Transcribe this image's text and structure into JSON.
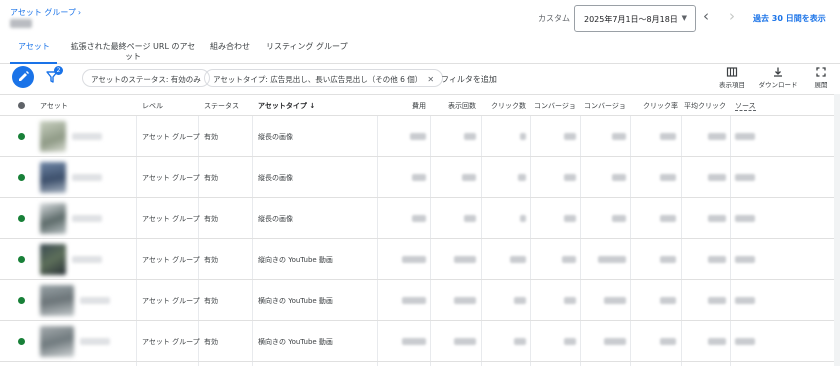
{
  "header": {
    "breadcrumb": "アセット グループ",
    "custom_label": "カスタム",
    "date_range": "2025年7月1日〜8月18日",
    "show_last_30": "過去 30 日間を表示"
  },
  "tabs": [
    {
      "label": "アセット",
      "active": true
    },
    {
      "label": "拡張された最終ページ URL のアセット",
      "active": false
    },
    {
      "label": "組み合わせ",
      "active": false
    },
    {
      "label": "リスティング グループ",
      "active": false
    }
  ],
  "toolbar": {
    "filter_count": "2",
    "chips": [
      "アセットのステータス: 有効のみ",
      "アセットタイプ: 広告見出し、長い広告見出し（その他 6 個）"
    ],
    "add_filter": "フィルタを追加",
    "columns_label": "表示項目",
    "download_label": "ダウンロード",
    "expand_label": "展開"
  },
  "table": {
    "headers": {
      "asset": "アセット",
      "level": "レベル",
      "status": "ステータス",
      "asset_type": "アセットタイプ",
      "cost": "費用",
      "impressions": "表示回数",
      "clicks": "クリック数",
      "conversions1": "コンバージョ",
      "conversions2": "コンバージョ",
      "ctr": "クリック率",
      "avg_cpc": "平均クリック",
      "source": "ソース"
    },
    "rows": [
      {
        "level": "アセット グループ",
        "status": "有効",
        "asset_type": "縦長の画像"
      },
      {
        "level": "アセット グループ",
        "status": "有効",
        "asset_type": "縦長の画像"
      },
      {
        "level": "アセット グループ",
        "status": "有効",
        "asset_type": "縦長の画像"
      },
      {
        "level": "アセット グループ",
        "status": "有効",
        "asset_type": "縦向きの YouTube 動画"
      },
      {
        "level": "アセット グループ",
        "status": "有効",
        "asset_type": "横向きの YouTube 動画"
      },
      {
        "level": "アセット グループ",
        "status": "有効",
        "asset_type": "横向きの YouTube 動画"
      }
    ]
  },
  "colors": {
    "accent": "#1a73e8",
    "status_active": "#188038",
    "border": "#e0e0e0"
  },
  "icons": [
    "pencil-icon",
    "filter-icon",
    "columns-icon",
    "download-icon",
    "expand-icon",
    "chevron-left-icon",
    "chevron-right-icon",
    "dropdown-caret-icon",
    "sort-arrow-icon",
    "close-icon"
  ]
}
